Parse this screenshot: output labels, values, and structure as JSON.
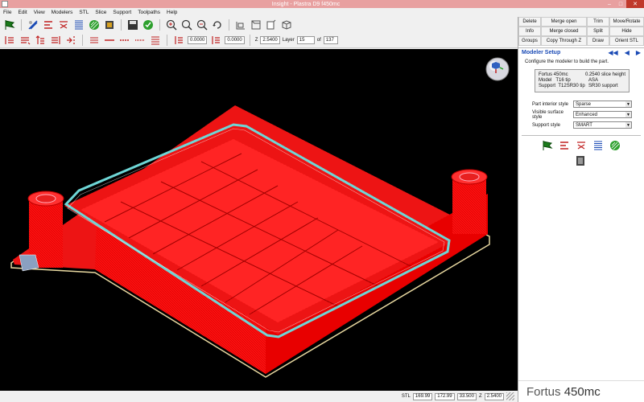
{
  "window": {
    "title": "Insight - Plastra D9 f450mc",
    "minimize": "–",
    "maximize": "□",
    "close": "✕"
  },
  "menu": [
    "File",
    "Edit",
    "View",
    "Modelers",
    "STL",
    "Slice",
    "Support",
    "Toolpaths",
    "Help"
  ],
  "toolbar2": {
    "field1": "0.0000",
    "field2": "0.0000",
    "z_label": "Z",
    "z_value": "2.5400",
    "layer_label": "Layer",
    "layer_value": "15",
    "of_label": "of",
    "layer_total": "137"
  },
  "right_buttons": [
    [
      "Delete",
      "Merge open",
      "Trim",
      "Move/Rotate"
    ],
    [
      "Info",
      "Merge closed",
      "Split",
      "Hide"
    ],
    [
      "Groups",
      "Copy Through Z",
      "Draw",
      "Orient STL"
    ]
  ],
  "modeler_setup": {
    "title": "Modeler Setup",
    "description": "Configure the modeler to build the part.",
    "info": {
      "machine": "Fortus 450mc",
      "slice_height": "0.2540 slice height",
      "model_label": "Model",
      "model_tip": "T16 tip",
      "model_material": "ASA",
      "support_label": "Support",
      "support_tip": "T12SR30 tip",
      "support_material": "SR30 support"
    },
    "styles": [
      {
        "label": "Part interior style",
        "value": "Sparse"
      },
      {
        "label": "Visible surface style",
        "value": "Enhanced"
      },
      {
        "label": "Support style",
        "value": "SMART"
      }
    ]
  },
  "status": {
    "mode": "STL",
    "x": "169.99",
    "y": "172.99",
    "z": "33.500",
    "z_label": "Z",
    "z_value": "2.5400"
  },
  "brand": {
    "name": "Fortus",
    "model": "450mc"
  },
  "colors": {
    "part": "#ff1010",
    "toolpath": "#6ed6d6",
    "viewport": "#000000",
    "accent": "#1a4ab5"
  }
}
